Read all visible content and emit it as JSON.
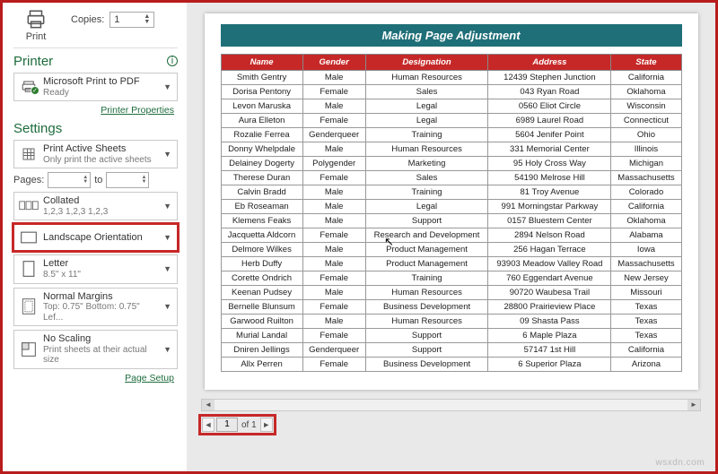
{
  "print": {
    "label": "Print",
    "copies_label": "Copies:",
    "copies_value": "1"
  },
  "printer": {
    "heading": "Printer",
    "device": "Microsoft Print to PDF",
    "status": "Ready",
    "properties_link": "Printer Properties"
  },
  "settings": {
    "heading": "Settings",
    "print_active": {
      "t1": "Print Active Sheets",
      "t2": "Only print the active sheets"
    },
    "pages_label": "Pages:",
    "pages_to": "to",
    "collated": {
      "t1": "Collated",
      "t2": "1,2,3   1,2,3   1,2,3"
    },
    "orientation": {
      "t1": "Landscape Orientation"
    },
    "paper": {
      "t1": "Letter",
      "t2": "8.5\" x 11\""
    },
    "margins": {
      "t1": "Normal Margins",
      "t2": "Top: 0.75\" Bottom: 0.75\" Lef..."
    },
    "scaling": {
      "t1": "No Scaling",
      "t2": "Print sheets at their actual size"
    },
    "page_setup_link": "Page Setup"
  },
  "doc": {
    "title": "Making Page Adjustment",
    "headers": [
      "Name",
      "Gender",
      "Designation",
      "Address",
      "State"
    ],
    "rows": [
      [
        "Smith Gentry",
        "Male",
        "Human Resources",
        "12439 Stephen Junction",
        "California"
      ],
      [
        "Dorisa Pentony",
        "Female",
        "Sales",
        "043 Ryan Road",
        "Oklahoma"
      ],
      [
        "Levon Maruska",
        "Male",
        "Legal",
        "0560 Eliot Circle",
        "Wisconsin"
      ],
      [
        "Aura Elleton",
        "Female",
        "Legal",
        "6989 Laurel Road",
        "Connecticut"
      ],
      [
        "Rozalie Ferrea",
        "Genderqueer",
        "Training",
        "5604 Jenifer Point",
        "Ohio"
      ],
      [
        "Donny Whelpdale",
        "Male",
        "Human Resources",
        "331 Memorial Center",
        "Illinois"
      ],
      [
        "Delainey Dogerty",
        "Polygender",
        "Marketing",
        "95 Holy Cross Way",
        "Michigan"
      ],
      [
        "Therese Duran",
        "Female",
        "Sales",
        "54190 Melrose Hill",
        "Massachusetts"
      ],
      [
        "Calvin Bradd",
        "Male",
        "Training",
        "81 Troy Avenue",
        "Colorado"
      ],
      [
        "Eb Roseaman",
        "Male",
        "Legal",
        "991 Morningstar Parkway",
        "California"
      ],
      [
        "Klemens Feaks",
        "Male",
        "Support",
        "0157 Bluestem Center",
        "Oklahoma"
      ],
      [
        "Jacquetta Aldcorn",
        "Female",
        "Research and Development",
        "2894 Nelson Road",
        "Alabama"
      ],
      [
        "Delmore Wilkes",
        "Male",
        "Product Management",
        "256 Hagan Terrace",
        "Iowa"
      ],
      [
        "Herb Duffy",
        "Male",
        "Product Management",
        "93903 Meadow Valley Road",
        "Massachusetts"
      ],
      [
        "Corette Ondrich",
        "Female",
        "Training",
        "760 Eggendart Avenue",
        "New Jersey"
      ],
      [
        "Keenan Pudsey",
        "Male",
        "Human Resources",
        "90720 Waubesa Trail",
        "Missouri"
      ],
      [
        "Bernelle Blunsum",
        "Female",
        "Business Development",
        "28800 Prairieview Place",
        "Texas"
      ],
      [
        "Garwood Ruilton",
        "Male",
        "Human Resources",
        "09 Shasta Pass",
        "Texas"
      ],
      [
        "Murial Landal",
        "Female",
        "Support",
        "6 Maple Plaza",
        "Texas"
      ],
      [
        "Dniren Jellings",
        "Genderqueer",
        "Support",
        "57147 1st Hill",
        "California"
      ],
      [
        "Allx Perren",
        "Female",
        "Business Development",
        "6 Superior Plaza",
        "Arizona"
      ]
    ]
  },
  "pager": {
    "current": "1",
    "of_label": "of 1"
  },
  "watermark": "wsxdn.com"
}
